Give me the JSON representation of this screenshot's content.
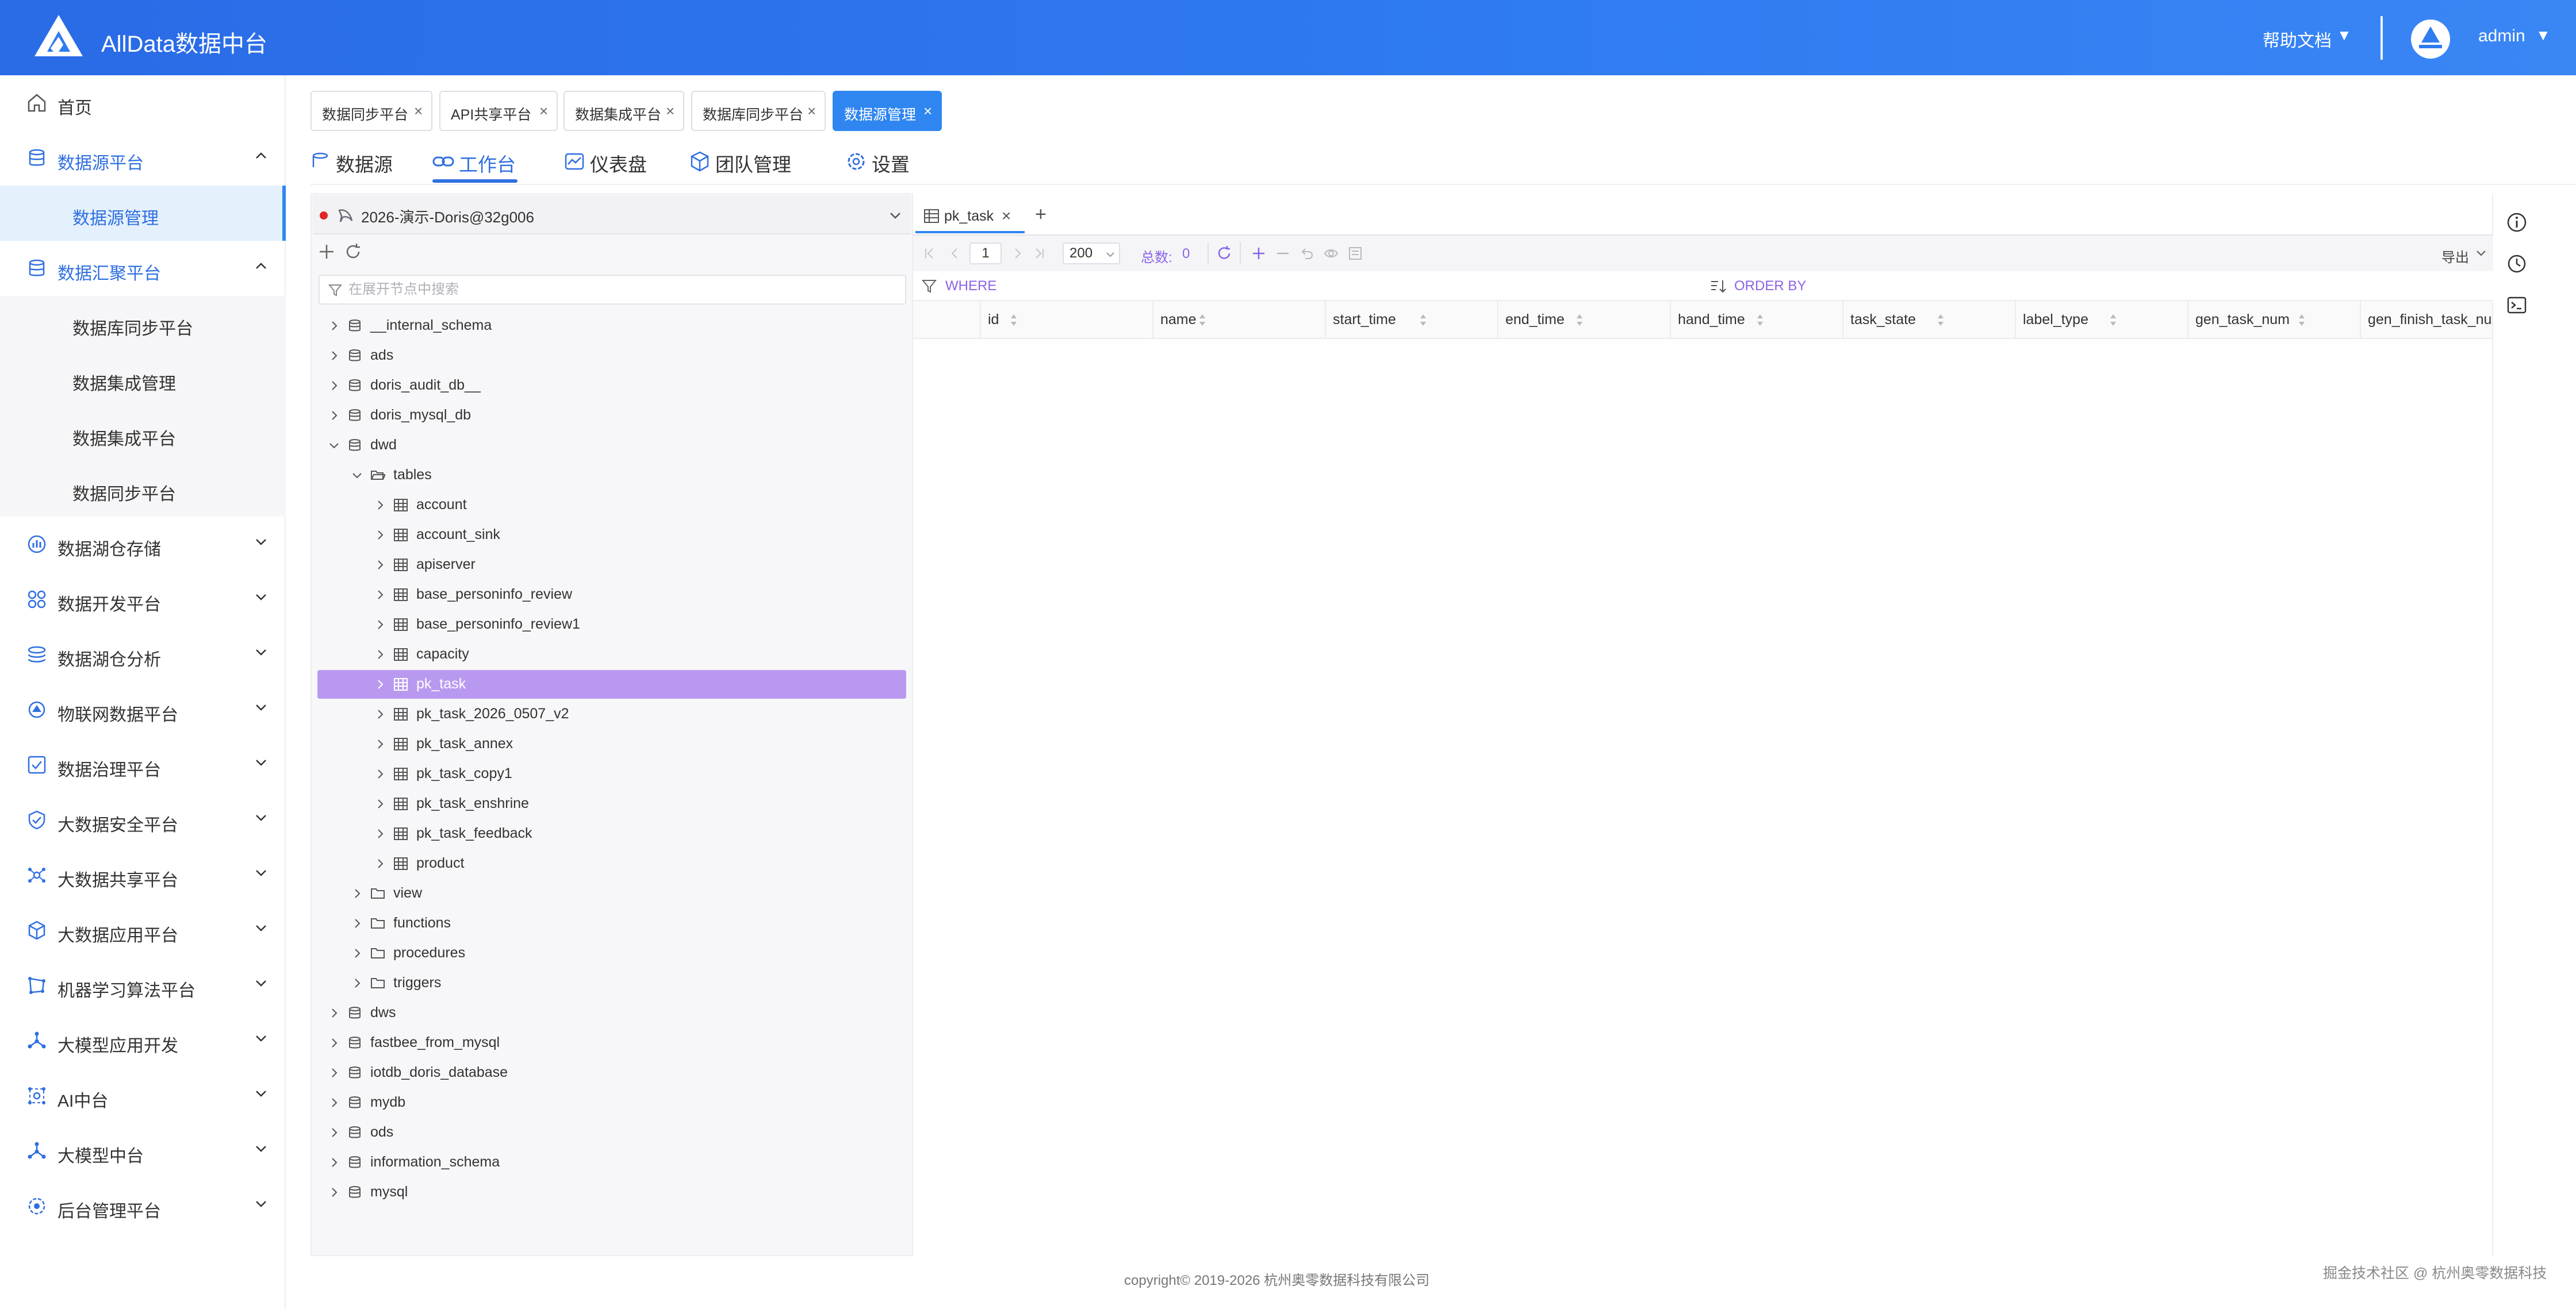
{
  "header": {
    "app_title": "AllData数据中台",
    "help_docs": "帮助文档",
    "username": "admin",
    "caret": "▼"
  },
  "sidebar": {
    "items": [
      {
        "label": "首页",
        "icon": "home-icon"
      },
      {
        "label": "数据源平台",
        "icon": "database-icon",
        "expanded": true
      },
      {
        "label": "数据源管理",
        "sub": true,
        "active": true
      },
      {
        "label": "数据汇聚平台",
        "icon": "database-icon",
        "expanded": true
      },
      {
        "label": "数据库同步平台",
        "sub": true
      },
      {
        "label": "数据集成管理",
        "sub": true
      },
      {
        "label": "数据集成平台",
        "sub": true
      },
      {
        "label": "数据同步平台",
        "sub": true
      },
      {
        "label": "数据湖仓存储",
        "icon": "bar-chart-icon"
      },
      {
        "label": "数据开发平台",
        "icon": "grid-icon"
      },
      {
        "label": "数据湖仓分析",
        "icon": "stack-icon"
      },
      {
        "label": "物联网数据平台",
        "icon": "iot-icon"
      },
      {
        "label": "数据治理平台",
        "icon": "checklist-icon"
      },
      {
        "label": "大数据安全平台",
        "icon": "shield-icon"
      },
      {
        "label": "大数据共享平台",
        "icon": "share-icon"
      },
      {
        "label": "大数据应用平台",
        "icon": "cube-icon"
      },
      {
        "label": "机器学习算法平台",
        "icon": "ml-icon"
      },
      {
        "label": "大模型应用开发",
        "icon": "network-icon"
      },
      {
        "label": "AI中台",
        "icon": "ai-icon"
      },
      {
        "label": "大模型中台",
        "icon": "network-icon"
      },
      {
        "label": "后台管理平台",
        "icon": "settings-icon"
      }
    ]
  },
  "open_tabs": [
    {
      "label": "数据同步平台"
    },
    {
      "label": "API共享平台"
    },
    {
      "label": "数据集成平台"
    },
    {
      "label": "数据库同步平台"
    },
    {
      "label": "数据源管理",
      "active": true
    }
  ],
  "close_glyph": "×",
  "subnav": [
    {
      "label": "数据源",
      "icon": "database-icon"
    },
    {
      "label": "工作台",
      "icon": "link-icon",
      "active": true
    },
    {
      "label": "仪表盘",
      "icon": "dashboard-icon"
    },
    {
      "label": "团队管理",
      "icon": "cube-icon"
    },
    {
      "label": "设置",
      "icon": "gear-icon"
    }
  ],
  "connection": {
    "label": "2026-演示-Doris@32g006",
    "status_color": "#e32626"
  },
  "tree_search_placeholder": "在展开节点中搜索",
  "tree": [
    {
      "label": "__internal_schema",
      "type": "db",
      "level": 0
    },
    {
      "label": "ads",
      "type": "db",
      "level": 0
    },
    {
      "label": "doris_audit_db__",
      "type": "db",
      "level": 0
    },
    {
      "label": "doris_mysql_db",
      "type": "db",
      "level": 0
    },
    {
      "label": "dwd",
      "type": "db",
      "level": 0,
      "expanded": true
    },
    {
      "label": "tables",
      "type": "folder",
      "level": 1,
      "expanded": true
    },
    {
      "label": "account",
      "type": "table",
      "level": 2
    },
    {
      "label": "account_sink",
      "type": "table",
      "level": 2
    },
    {
      "label": "apiserver",
      "type": "table",
      "level": 2
    },
    {
      "label": "base_personinfo_review",
      "type": "table",
      "level": 2
    },
    {
      "label": "base_personinfo_review1",
      "type": "table",
      "level": 2
    },
    {
      "label": "capacity",
      "type": "table",
      "level": 2
    },
    {
      "label": "pk_task",
      "type": "table",
      "level": 2,
      "selected": true
    },
    {
      "label": "pk_task_2026_0507_v2",
      "type": "table",
      "level": 2
    },
    {
      "label": "pk_task_annex",
      "type": "table",
      "level": 2
    },
    {
      "label": "pk_task_copy1",
      "type": "table",
      "level": 2
    },
    {
      "label": "pk_task_enshrine",
      "type": "table",
      "level": 2
    },
    {
      "label": "pk_task_feedback",
      "type": "table",
      "level": 2
    },
    {
      "label": "product",
      "type": "table",
      "level": 2
    },
    {
      "label": "view",
      "type": "folder",
      "level": 1
    },
    {
      "label": "functions",
      "type": "folder",
      "level": 1
    },
    {
      "label": "procedures",
      "type": "folder",
      "level": 1
    },
    {
      "label": "triggers",
      "type": "folder",
      "level": 1
    },
    {
      "label": "dws",
      "type": "db",
      "level": 0
    },
    {
      "label": "fastbee_from_mysql",
      "type": "db",
      "level": 0
    },
    {
      "label": "iotdb_doris_database",
      "type": "db",
      "level": 0
    },
    {
      "label": "mydb",
      "type": "db",
      "level": 0
    },
    {
      "label": "ods",
      "type": "db",
      "level": 0
    },
    {
      "label": "information_schema",
      "type": "db",
      "level": 0
    },
    {
      "label": "mysql",
      "type": "db",
      "level": 0
    }
  ],
  "query_tab": {
    "label": "pk_task",
    "add": "+"
  },
  "data_toolbar": {
    "page": "1",
    "page_size": "200",
    "total_label": "总数:",
    "total_value": "0",
    "export_label": "导出"
  },
  "filters": {
    "where": "WHERE",
    "order_by": "ORDER BY"
  },
  "columns": [
    "id",
    "name",
    "start_time",
    "end_time",
    "hand_time",
    "task_state",
    "label_type",
    "gen_task_num",
    "gen_finish_task_num"
  ],
  "footer": {
    "copyright": "copyright© 2019-2026 杭州奥零数据科技有限公司",
    "watermark": "掘金技术社区 @ 杭州奥零数据科技"
  },
  "colors": {
    "header_blue": "#2f7bf0",
    "accent_blue": "#2f6fe0",
    "selected_purple": "#b999f0",
    "filter_purple": "#8a63e8"
  }
}
